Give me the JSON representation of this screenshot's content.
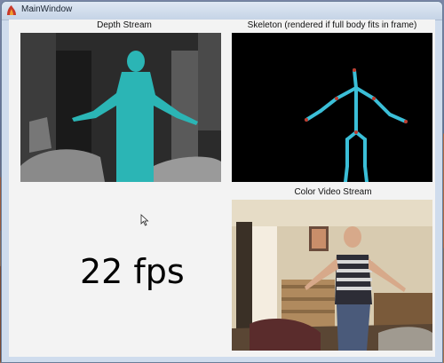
{
  "window": {
    "title": "MainWindow"
  },
  "panels": {
    "depth": {
      "title": "Depth Stream"
    },
    "skeleton": {
      "title": "Skeleton (rendered if full body fits in frame)"
    },
    "color": {
      "title": "Color Video Stream"
    }
  },
  "fps": {
    "text": "22 fps"
  },
  "colors": {
    "body_highlight": "#2bb5b5",
    "bone": "#3bbfd8",
    "joint": "#c0392b",
    "skeleton_background": "#000000"
  },
  "icons": {
    "app": "app-icon",
    "cursor": "mouse-cursor-icon"
  }
}
